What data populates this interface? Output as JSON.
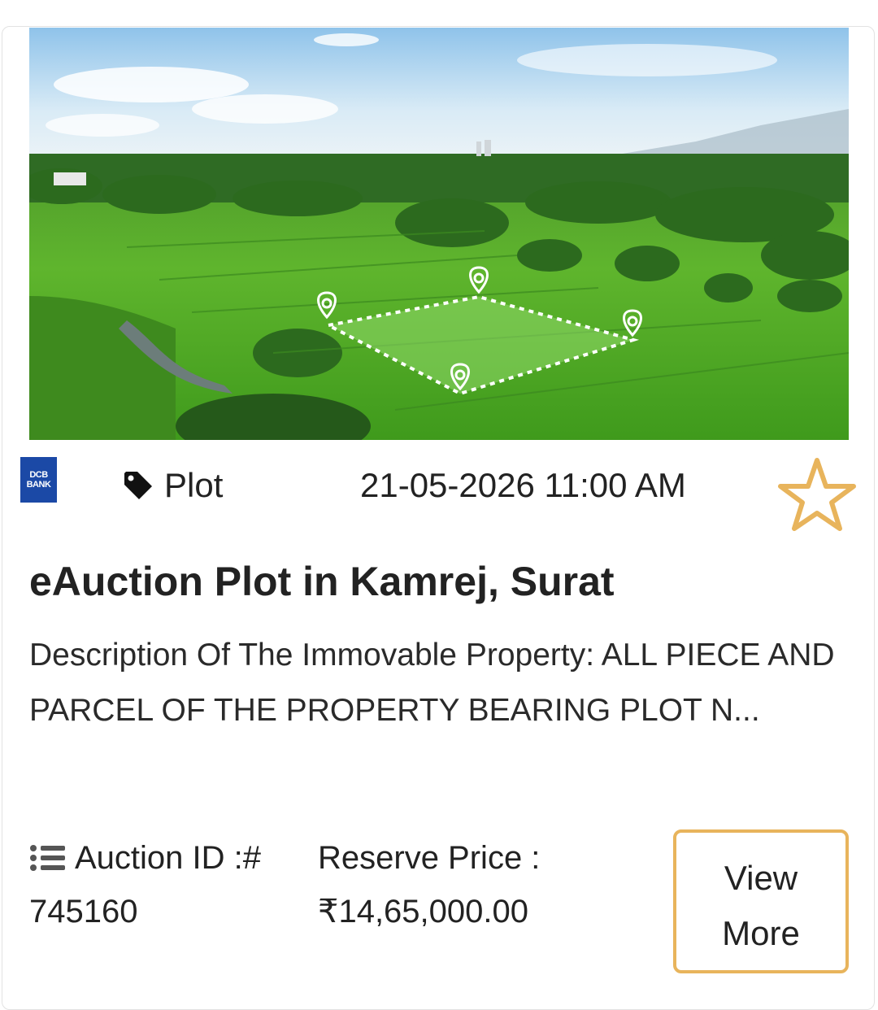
{
  "card": {
    "image": {
      "description_icon": "farmland-plot-image"
    },
    "bank": {
      "line1": "DCB",
      "line2": "BANK",
      "color": "#1b49a6"
    },
    "category": {
      "icon": "tag-icon",
      "label": "Plot"
    },
    "datetime": "21-05-2026 11:00 AM",
    "favorite": {
      "icon": "star-outline-icon",
      "color": "#e8b45c"
    },
    "title": "eAuction Plot in Kamrej, Surat",
    "description": "Description Of The Immovable Property: ALL PIECE AND PARCEL OF THE PROPERTY BEARING PLOT N...",
    "auction_id": {
      "icon": "list-icon",
      "label": "Auction ID :#",
      "value": "745160"
    },
    "reserve_price": {
      "label": "Reserve Price :",
      "value": "₹14,65,000.00"
    },
    "view_more": {
      "line1": "View",
      "line2": "More",
      "border_color": "#e8b45c"
    }
  }
}
